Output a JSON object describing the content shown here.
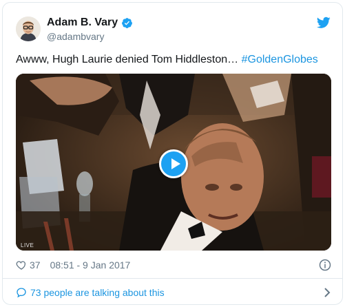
{
  "author": {
    "name": "Adam B. Vary",
    "handle": "@adambvary",
    "verified": true
  },
  "tweet": {
    "text": "Awww, Hugh Laurie denied Tom Hiddleston… ",
    "hashtag": "#GoldenGlobes"
  },
  "media": {
    "overlay_label": "LIVE",
    "play_icon": "play-button-icon"
  },
  "meta": {
    "likes": "37",
    "timestamp": "08:51 - 9 Jan 2017"
  },
  "footer": {
    "talking_text": "73 people are talking about this"
  },
  "colors": {
    "brand": "#1da1f2",
    "link": "#1b95e0",
    "secondary_text": "#657786",
    "border": "#e1e8ed"
  }
}
